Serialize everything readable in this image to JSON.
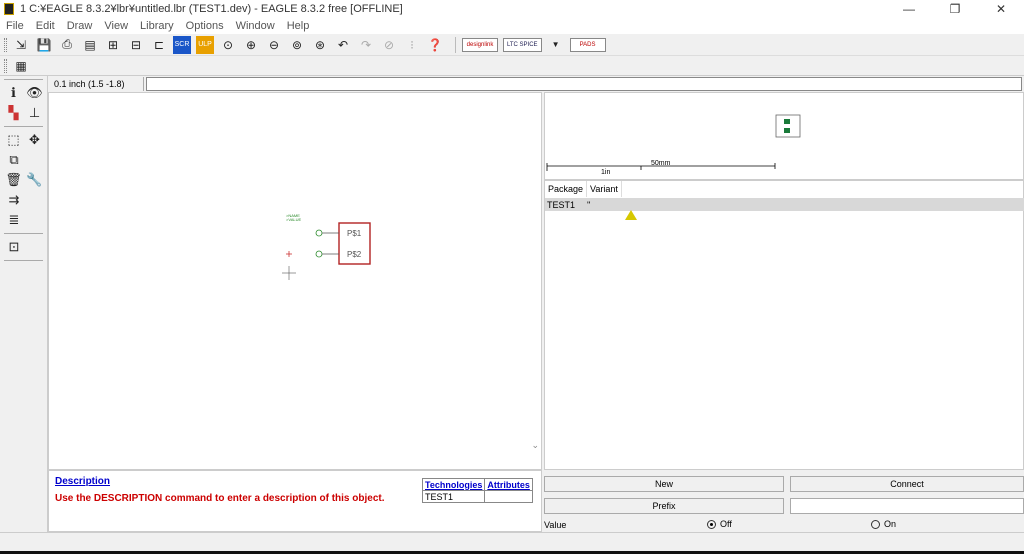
{
  "window": {
    "title": "1 C:¥EAGLE 8.3.2¥lbr¥untitled.lbr (TEST1.dev) - EAGLE 8.3.2 free [OFFLINE]",
    "minimize": "—",
    "restore": "❐",
    "close": "✕"
  },
  "menu": [
    "File",
    "Edit",
    "Draw",
    "View",
    "Library",
    "Options",
    "Window",
    "Help"
  ],
  "toolbar": {
    "logo_design_link": "designlink",
    "logo_ltc_spice": "LTC SPICE",
    "logo_pads": "PADS"
  },
  "coordinates": "0.1 inch (1.5 -1.8)",
  "canvas": {
    "symbol_name": "P$1",
    "symbol_name2": "P$2",
    "small_label1": ">NAME",
    "small_label2": ">VALUE"
  },
  "preview": {
    "scale_metric": "50mm",
    "scale_imperial": "1in"
  },
  "packages": {
    "headers": [
      "Package",
      "Variant"
    ],
    "rows": [
      {
        "package": "TEST1",
        "variant": "''"
      }
    ]
  },
  "description": {
    "link": "Description",
    "text": "Use the DESCRIPTION command to enter a description of this object."
  },
  "technologies": {
    "header_tech": "Technologies",
    "header_attr": "Attributes",
    "row": "TEST1"
  },
  "controls": {
    "new": "New",
    "connect": "Connect",
    "prefix": "Prefix",
    "value": "Value",
    "off": "Off",
    "on": "On",
    "value_selected": "Off"
  },
  "colors": {
    "symbol_outline": "#b22222",
    "pin_green": "#2a8a2a",
    "desc_red": "#cc0000",
    "link_blue": "#0000cc"
  }
}
